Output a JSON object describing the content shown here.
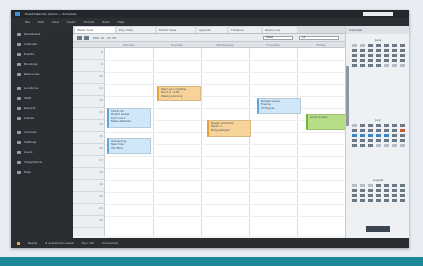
{
  "window": {
    "title": "EventCalendar Admin — Schedule"
  },
  "menu": {
    "items": [
      "File",
      "Edit",
      "View",
      "Insert",
      "Format",
      "Tools",
      "Help"
    ]
  },
  "sidebar": {
    "items": [
      {
        "label": "Dashboard"
      },
      {
        "label": "Calendar"
      },
      {
        "label": "Events"
      },
      {
        "label": "Bookings"
      },
      {
        "label": "Resources"
      },
      {
        "label": "Locations"
      },
      {
        "label": "Staff"
      },
      {
        "label": "Reports"
      },
      {
        "label": "Clients"
      },
      {
        "label": "Invoices"
      },
      {
        "label": "Settings"
      },
      {
        "label": "Users"
      },
      {
        "label": "Integrations"
      },
      {
        "label": "Help"
      }
    ]
  },
  "tabs": [
    "Week View",
    "Day View",
    "Month View",
    "Agenda",
    "Timeline",
    "Resources"
  ],
  "toolbar": {
    "date_range": "Mon 12 – Fri 16",
    "view_select": "Week",
    "filter_select": "All"
  },
  "columns": [
    "Monday",
    "Tuesday",
    "Wednesday",
    "Thursday",
    "Friday"
  ],
  "hours": [
    "8",
    "9",
    "10",
    "11",
    "12",
    "13",
    "14",
    "15",
    "16",
    "17",
    "18",
    "19",
    "20",
    "21",
    "22"
  ],
  "events": [
    {
      "lines": [
        "Team sync meeting",
        "Room A · 9:00",
        "Weekly planning"
      ],
      "color": "orange"
    },
    {
      "lines": [
        "Client call",
        "Project review",
        "Conf. line 2",
        "Notes attached"
      ],
      "color": "blue"
    },
    {
      "lines": [
        "Design workshop",
        "Studio 3",
        "Bring samples"
      ],
      "color": "orange"
    },
    {
      "lines": [
        "Budget review",
        "Finance",
        "Q3 figures"
      ],
      "color": "blue"
    },
    {
      "lines": [
        "Lunch & learn"
      ],
      "color": "green"
    },
    {
      "lines": [
        "Onboarding",
        "New hires",
        "HR office"
      ],
      "color": "blue"
    }
  ],
  "right_panel": {
    "title": "Calendar",
    "cal1_title": "June",
    "cal2_title": "July",
    "cal3_title": "August"
  },
  "status": {
    "items": [
      "Ready",
      "6 events this week",
      "Sync OK",
      "Connected"
    ]
  },
  "colors": {
    "accent": "#1c8a96",
    "blue_event": "#cfe7f8",
    "orange_event": "#f7d39a",
    "green_event": "#b7dd86",
    "sidebar_bg": "#2a2e33"
  }
}
